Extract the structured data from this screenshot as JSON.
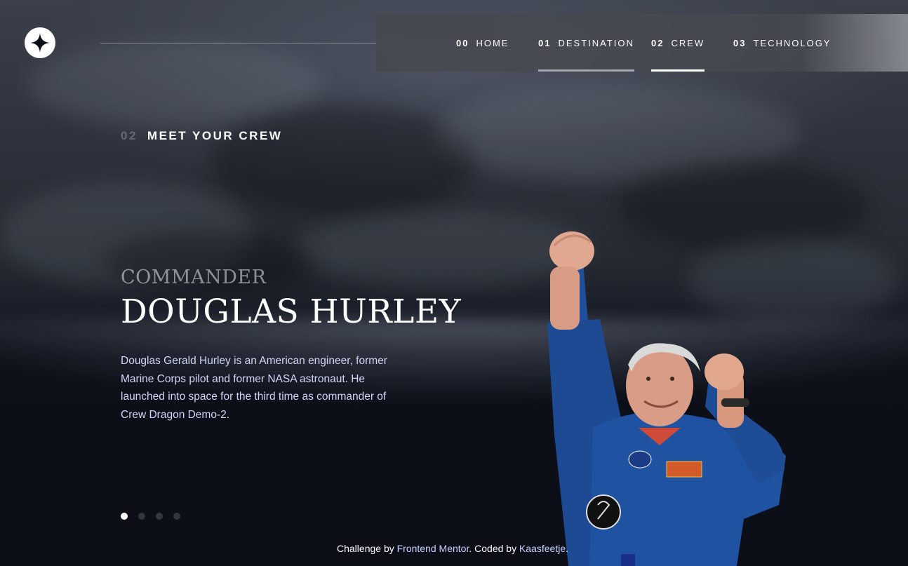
{
  "nav": {
    "items": [
      {
        "num": "00",
        "label": "HOME",
        "state": "normal"
      },
      {
        "num": "01",
        "label": "DESTINATION",
        "state": "hover"
      },
      {
        "num": "02",
        "label": "CREW",
        "state": "active"
      },
      {
        "num": "03",
        "label": "TECHNOLOGY",
        "state": "normal"
      }
    ]
  },
  "page": {
    "heading_num": "02",
    "heading": "MEET YOUR CREW"
  },
  "crew": {
    "role": "Commander",
    "name": "Douglas Hurley",
    "bio": "Douglas Gerald Hurley is an American engineer, former Marine Corps pilot and former NASA astronaut. He launched into space for the third time as commander of Crew Dragon Demo-2.",
    "active_index": 0,
    "total": 4
  },
  "footer": {
    "prefix": "Challenge by ",
    "link1": "Frontend Mentor",
    "middle": ". Coded by ",
    "link2": "Kaasfeetje",
    "suffix": "."
  },
  "colors": {
    "background": "#0b0d17",
    "text_light": "#d0d6f9",
    "suit_blue": "#1f4f9a",
    "white": "#ffffff"
  },
  "icons": {
    "logo": "star-logo-icon"
  }
}
